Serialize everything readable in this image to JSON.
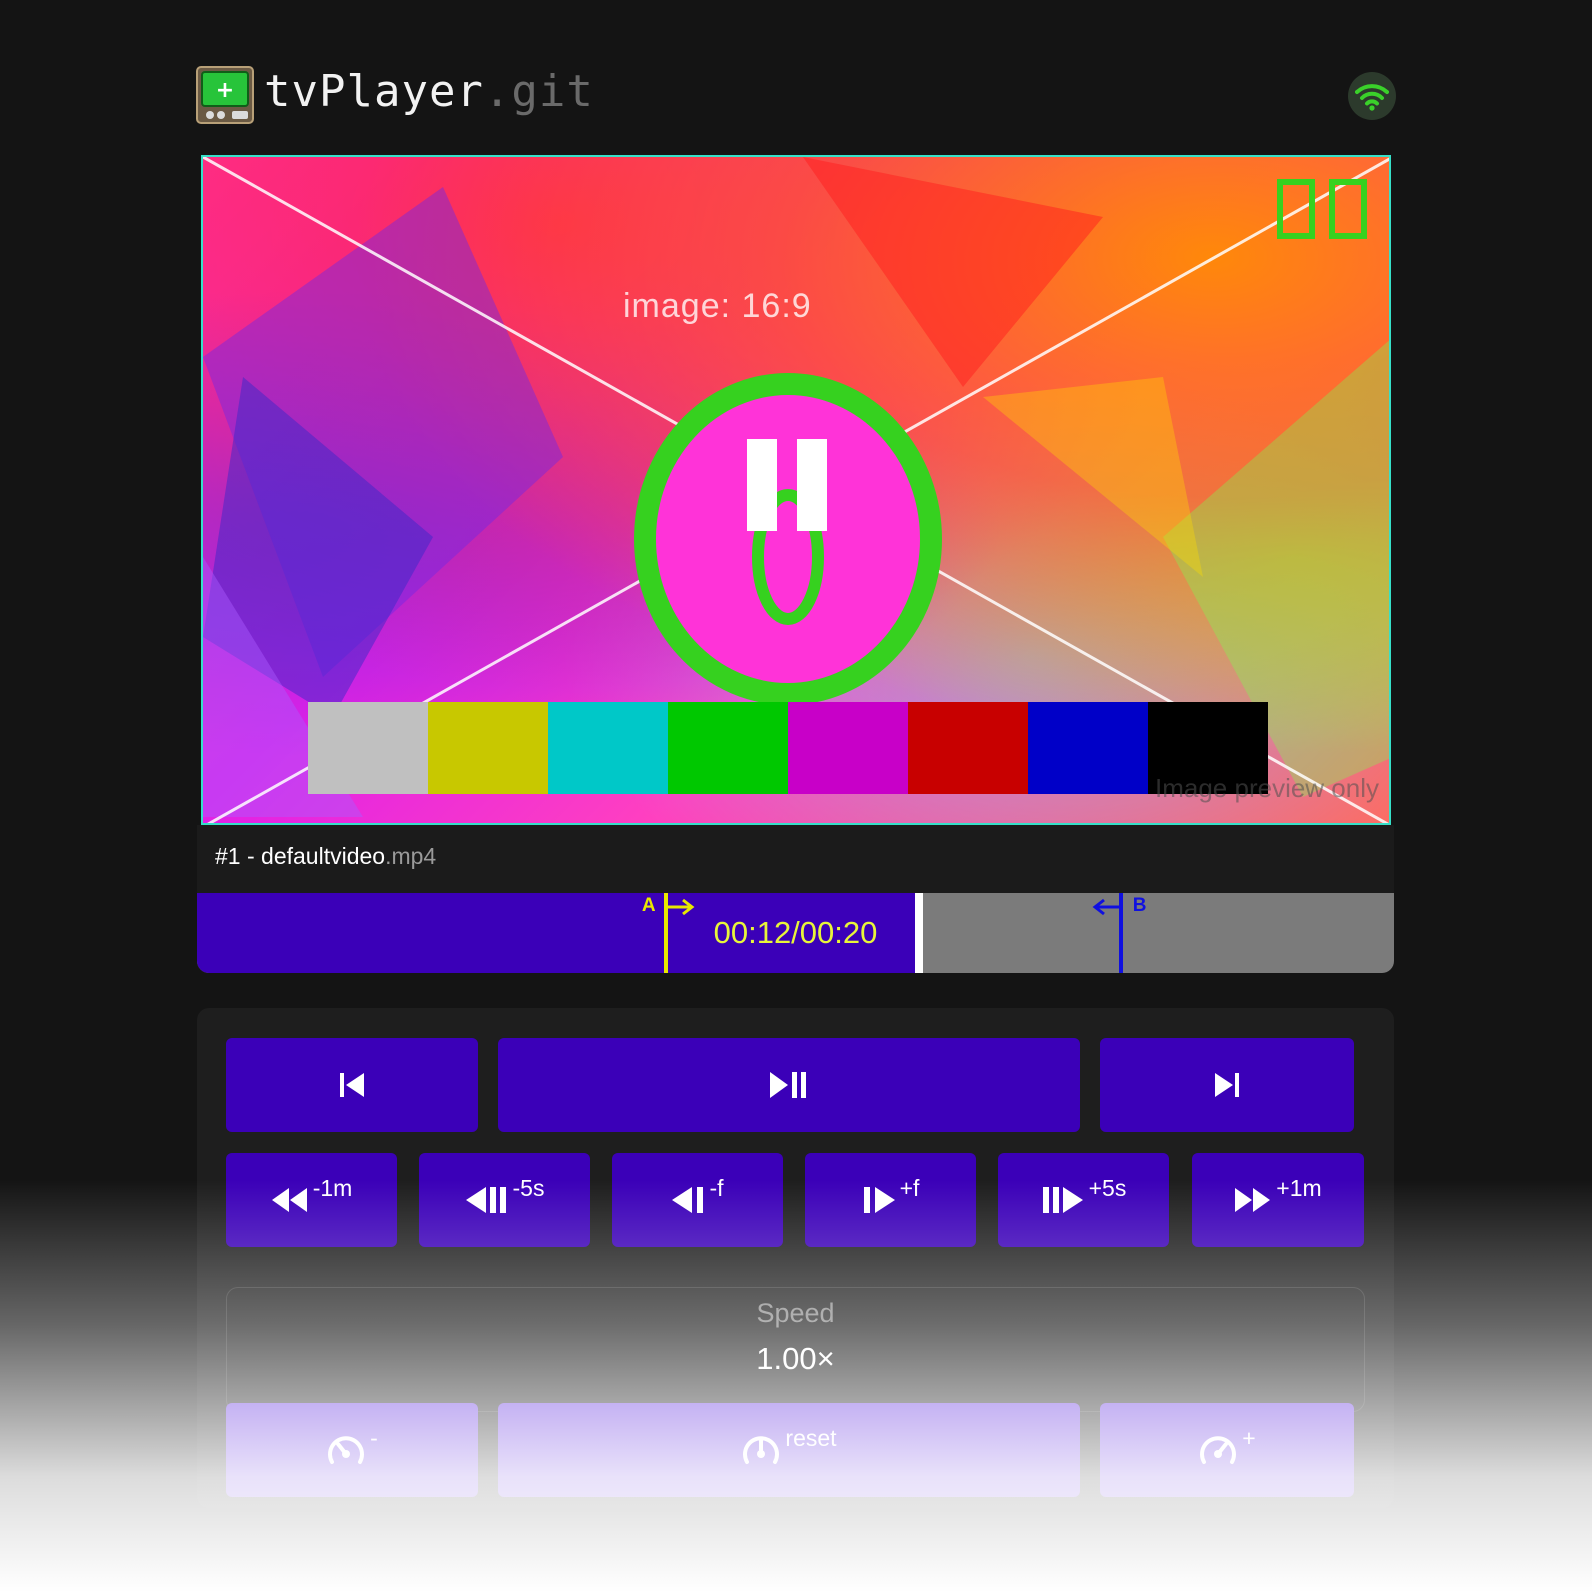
{
  "app": {
    "name": "tvPlayer",
    "name_suffix": ".git",
    "logo_icon": "retro-tv-plus-icon",
    "status_icon": "wifi-icon",
    "status_color": "#3ad12a"
  },
  "video": {
    "aspect_label": "image: 16:9",
    "segment_counter": "00",
    "countdown_digit": "0",
    "overlay_icon": "pause-icon",
    "preview_note": "Image preview only",
    "color_bars": [
      "#c0c0c0",
      "#c8c800",
      "#00c8c8",
      "#00c800",
      "#c800c8",
      "#c80000",
      "#0000c8",
      "#000000"
    ],
    "border_color": "#36e0c8",
    "digit_color": "#36d11f"
  },
  "file": {
    "index_label": "#1 - ",
    "name": "defaultvideo",
    "ext": ".mp4"
  },
  "timeline": {
    "current": "00:12",
    "total": "00:20",
    "display": "00:12/00:20",
    "progress": 0.6,
    "marker_a": {
      "label": "A",
      "position": 0.39,
      "color": "#e8e800"
    },
    "marker_b": {
      "label": "B",
      "position": 0.77,
      "color": "#1010e0"
    },
    "fill_color": "#3b00b8",
    "time_color": "#e8f53a"
  },
  "controls": {
    "transport": [
      {
        "name": "previous",
        "icon": "skip-previous-icon"
      },
      {
        "name": "play-pause",
        "icon": "play-pause-icon"
      },
      {
        "name": "next",
        "icon": "skip-next-icon"
      }
    ],
    "seek": [
      {
        "label": "-1m",
        "icon": "rewind-icon"
      },
      {
        "label": "-5s",
        "icon": "step-back-icon"
      },
      {
        "label": "-f",
        "icon": "frame-back-icon"
      },
      {
        "label": "+f",
        "icon": "frame-forward-icon"
      },
      {
        "label": "+5s",
        "icon": "step-forward-icon"
      },
      {
        "label": "+1m",
        "icon": "fast-forward-icon"
      }
    ],
    "speed": {
      "title": "Speed",
      "value": "1.00×",
      "decrease_label": "-",
      "reset_label": "reset",
      "increase_label": "+"
    },
    "button_color": "#3b00b8"
  }
}
